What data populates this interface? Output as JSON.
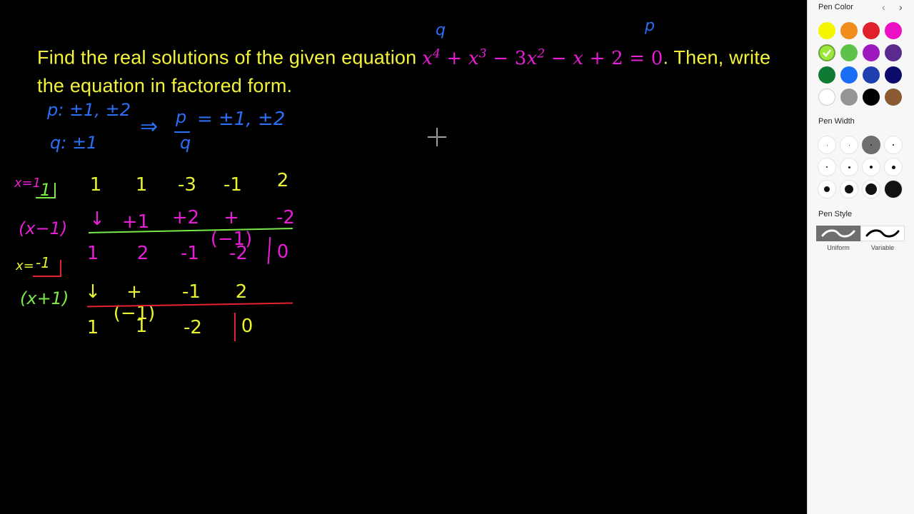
{
  "problem": {
    "text_before": "Find the real solutions of the given equation ",
    "equation_parts": [
      "x",
      "4",
      " + ",
      "x",
      "3",
      " − 3",
      "x",
      "2",
      " − ",
      "x",
      " + 2 = 0"
    ],
    "text_after": ". Then, write the equation in factored form."
  },
  "annotations": {
    "q_label": "q",
    "p_label": "p",
    "p_factors": "p: ±1, ±2",
    "q_factors": "q: ±1",
    "implies": "⇒",
    "ratio_p": "p",
    "ratio_q": "q",
    "ratio_values": "= ±1, ±2"
  },
  "synthetic_division": {
    "root1_label": "x=1",
    "root1_box": "1",
    "factor1": "(x−1)",
    "row1": [
      "1",
      "1",
      "-3",
      "-1",
      "2"
    ],
    "row2": [
      "↓",
      "+1",
      "+2",
      "+(−1)",
      "-2"
    ],
    "row3": [
      "1",
      "2",
      "-1",
      "-2",
      "0"
    ],
    "root2_label": "x=",
    "root2_box": "-1",
    "factor2": "(x+1)",
    "row4": [
      "↓",
      "+(−1)",
      "-1",
      "2"
    ],
    "row5": [
      "1",
      "1",
      "-2",
      "0"
    ]
  },
  "panel": {
    "pen_color_title": "Pen Color",
    "pen_width_title": "Pen Width",
    "pen_style_title": "Pen Style",
    "colors": [
      "#f5f500",
      "#f08c1c",
      "#e0202a",
      "#ec10c4",
      "#9be83a",
      "#5ec24a",
      "#9d1ac0",
      "#5a2a8c",
      "#0e7a34",
      "#1a6ef5",
      "#1f3fb0",
      "#0c0a6a",
      "#ffffff",
      "#959595",
      "#000000",
      "#8a5a30"
    ],
    "selected_color_index": 4,
    "style_uniform": "Uniform",
    "style_variable": "Variable"
  }
}
